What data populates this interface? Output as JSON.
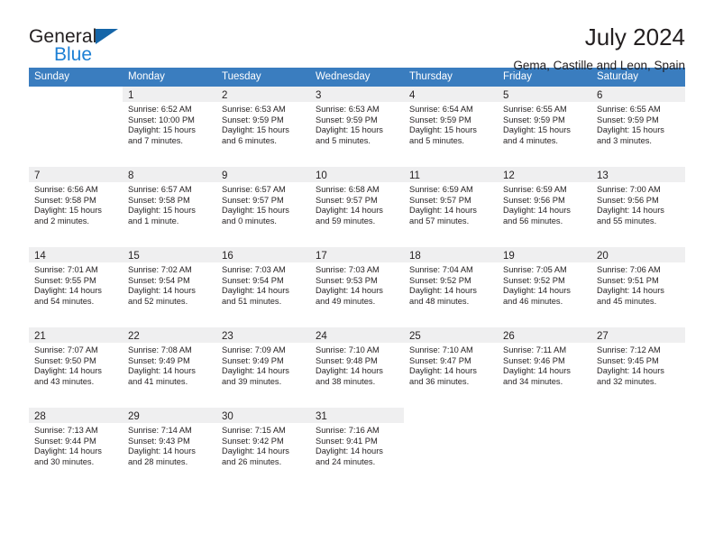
{
  "brand": {
    "line1": "General",
    "line2": "Blue",
    "triangle_color": "#1565a8"
  },
  "header": {
    "title": "July 2024",
    "location": "Gema, Castille and Leon, Spain"
  },
  "theme": {
    "header_blue": "#3a7dbf",
    "divider_blue": "#1f5fa0",
    "daynum_band": "#efeff0",
    "text": "#231f20"
  },
  "weekdays": [
    "Sunday",
    "Monday",
    "Tuesday",
    "Wednesday",
    "Thursday",
    "Friday",
    "Saturday"
  ],
  "weeks": [
    {
      "filled_columns": 7,
      "days": [
        {
          "num": "",
          "lines": []
        },
        {
          "num": "1",
          "lines": [
            "Sunrise: 6:52 AM",
            "Sunset: 10:00 PM",
            "Daylight: 15 hours",
            "and 7 minutes."
          ]
        },
        {
          "num": "2",
          "lines": [
            "Sunrise: 6:53 AM",
            "Sunset: 9:59 PM",
            "Daylight: 15 hours",
            "and 6 minutes."
          ]
        },
        {
          "num": "3",
          "lines": [
            "Sunrise: 6:53 AM",
            "Sunset: 9:59 PM",
            "Daylight: 15 hours",
            "and 5 minutes."
          ]
        },
        {
          "num": "4",
          "lines": [
            "Sunrise: 6:54 AM",
            "Sunset: 9:59 PM",
            "Daylight: 15 hours",
            "and 5 minutes."
          ]
        },
        {
          "num": "5",
          "lines": [
            "Sunrise: 6:55 AM",
            "Sunset: 9:59 PM",
            "Daylight: 15 hours",
            "and 4 minutes."
          ]
        },
        {
          "num": "6",
          "lines": [
            "Sunrise: 6:55 AM",
            "Sunset: 9:59 PM",
            "Daylight: 15 hours",
            "and 3 minutes."
          ]
        }
      ]
    },
    {
      "filled_columns": 7,
      "days": [
        {
          "num": "7",
          "lines": [
            "Sunrise: 6:56 AM",
            "Sunset: 9:58 PM",
            "Daylight: 15 hours",
            "and 2 minutes."
          ]
        },
        {
          "num": "8",
          "lines": [
            "Sunrise: 6:57 AM",
            "Sunset: 9:58 PM",
            "Daylight: 15 hours",
            "and 1 minute."
          ]
        },
        {
          "num": "9",
          "lines": [
            "Sunrise: 6:57 AM",
            "Sunset: 9:57 PM",
            "Daylight: 15 hours",
            "and 0 minutes."
          ]
        },
        {
          "num": "10",
          "lines": [
            "Sunrise: 6:58 AM",
            "Sunset: 9:57 PM",
            "Daylight: 14 hours",
            "and 59 minutes."
          ]
        },
        {
          "num": "11",
          "lines": [
            "Sunrise: 6:59 AM",
            "Sunset: 9:57 PM",
            "Daylight: 14 hours",
            "and 57 minutes."
          ]
        },
        {
          "num": "12",
          "lines": [
            "Sunrise: 6:59 AM",
            "Sunset: 9:56 PM",
            "Daylight: 14 hours",
            "and 56 minutes."
          ]
        },
        {
          "num": "13",
          "lines": [
            "Sunrise: 7:00 AM",
            "Sunset: 9:56 PM",
            "Daylight: 14 hours",
            "and 55 minutes."
          ]
        }
      ]
    },
    {
      "filled_columns": 7,
      "days": [
        {
          "num": "14",
          "lines": [
            "Sunrise: 7:01 AM",
            "Sunset: 9:55 PM",
            "Daylight: 14 hours",
            "and 54 minutes."
          ]
        },
        {
          "num": "15",
          "lines": [
            "Sunrise: 7:02 AM",
            "Sunset: 9:54 PM",
            "Daylight: 14 hours",
            "and 52 minutes."
          ]
        },
        {
          "num": "16",
          "lines": [
            "Sunrise: 7:03 AM",
            "Sunset: 9:54 PM",
            "Daylight: 14 hours",
            "and 51 minutes."
          ]
        },
        {
          "num": "17",
          "lines": [
            "Sunrise: 7:03 AM",
            "Sunset: 9:53 PM",
            "Daylight: 14 hours",
            "and 49 minutes."
          ]
        },
        {
          "num": "18",
          "lines": [
            "Sunrise: 7:04 AM",
            "Sunset: 9:52 PM",
            "Daylight: 14 hours",
            "and 48 minutes."
          ]
        },
        {
          "num": "19",
          "lines": [
            "Sunrise: 7:05 AM",
            "Sunset: 9:52 PM",
            "Daylight: 14 hours",
            "and 46 minutes."
          ]
        },
        {
          "num": "20",
          "lines": [
            "Sunrise: 7:06 AM",
            "Sunset: 9:51 PM",
            "Daylight: 14 hours",
            "and 45 minutes."
          ]
        }
      ]
    },
    {
      "filled_columns": 7,
      "days": [
        {
          "num": "21",
          "lines": [
            "Sunrise: 7:07 AM",
            "Sunset: 9:50 PM",
            "Daylight: 14 hours",
            "and 43 minutes."
          ]
        },
        {
          "num": "22",
          "lines": [
            "Sunrise: 7:08 AM",
            "Sunset: 9:49 PM",
            "Daylight: 14 hours",
            "and 41 minutes."
          ]
        },
        {
          "num": "23",
          "lines": [
            "Sunrise: 7:09 AM",
            "Sunset: 9:49 PM",
            "Daylight: 14 hours",
            "and 39 minutes."
          ]
        },
        {
          "num": "24",
          "lines": [
            "Sunrise: 7:10 AM",
            "Sunset: 9:48 PM",
            "Daylight: 14 hours",
            "and 38 minutes."
          ]
        },
        {
          "num": "25",
          "lines": [
            "Sunrise: 7:10 AM",
            "Sunset: 9:47 PM",
            "Daylight: 14 hours",
            "and 36 minutes."
          ]
        },
        {
          "num": "26",
          "lines": [
            "Sunrise: 7:11 AM",
            "Sunset: 9:46 PM",
            "Daylight: 14 hours",
            "and 34 minutes."
          ]
        },
        {
          "num": "27",
          "lines": [
            "Sunrise: 7:12 AM",
            "Sunset: 9:45 PM",
            "Daylight: 14 hours",
            "and 32 minutes."
          ]
        }
      ]
    },
    {
      "filled_columns": 4,
      "days": [
        {
          "num": "28",
          "lines": [
            "Sunrise: 7:13 AM",
            "Sunset: 9:44 PM",
            "Daylight: 14 hours",
            "and 30 minutes."
          ]
        },
        {
          "num": "29",
          "lines": [
            "Sunrise: 7:14 AM",
            "Sunset: 9:43 PM",
            "Daylight: 14 hours",
            "and 28 minutes."
          ]
        },
        {
          "num": "30",
          "lines": [
            "Sunrise: 7:15 AM",
            "Sunset: 9:42 PM",
            "Daylight: 14 hours",
            "and 26 minutes."
          ]
        },
        {
          "num": "31",
          "lines": [
            "Sunrise: 7:16 AM",
            "Sunset: 9:41 PM",
            "Daylight: 14 hours",
            "and 24 minutes."
          ]
        },
        {
          "num": "",
          "lines": []
        },
        {
          "num": "",
          "lines": []
        },
        {
          "num": "",
          "lines": []
        }
      ]
    }
  ]
}
